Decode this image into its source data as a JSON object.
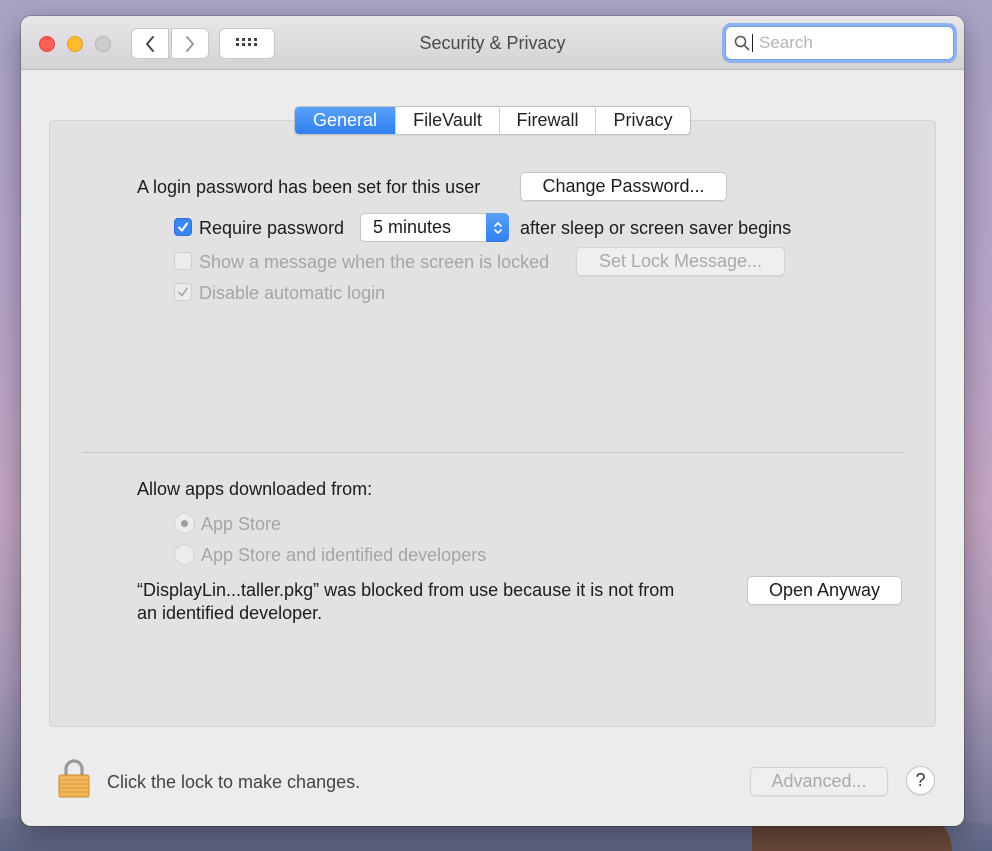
{
  "window": {
    "title": "Security & Privacy",
    "search": {
      "placeholder": "Search",
      "value": ""
    }
  },
  "tabs": [
    {
      "label": "General",
      "active": true
    },
    {
      "label": "FileVault",
      "active": false
    },
    {
      "label": "Firewall",
      "active": false
    },
    {
      "label": "Privacy",
      "active": false
    }
  ],
  "general": {
    "login_password_text": "A login password has been set for this user",
    "change_password_button": "Change Password...",
    "require_password": {
      "label": "Require password",
      "checked": true
    },
    "require_password_delay": "5 minutes",
    "after_sleep_text": "after sleep or screen saver begins",
    "show_message": {
      "label": "Show a message when the screen is locked",
      "checked": false,
      "enabled": false
    },
    "set_lock_message_button": "Set Lock Message...",
    "disable_auto_login": {
      "label": "Disable automatic login",
      "checked": true,
      "enabled": false
    }
  },
  "gatekeeper": {
    "heading": "Allow apps downloaded from:",
    "options": [
      {
        "label": "App Store",
        "selected": true,
        "enabled": false
      },
      {
        "label": "App Store and identified developers",
        "selected": false,
        "enabled": false
      }
    ],
    "blocked_message_line1": "“DisplayLin...taller.pkg” was blocked from use because it is not from",
    "blocked_message_line2": "an identified developer.",
    "open_anyway_button": "Open Anyway"
  },
  "footer": {
    "lock_text": "Click the lock to make changes.",
    "advanced_button": "Advanced...",
    "help_button": "?"
  },
  "colors": {
    "accent": "#3b86f3",
    "close": "#fe5f57",
    "minimize": "#febb2e",
    "zoom_disabled": "#cdcbcd"
  }
}
